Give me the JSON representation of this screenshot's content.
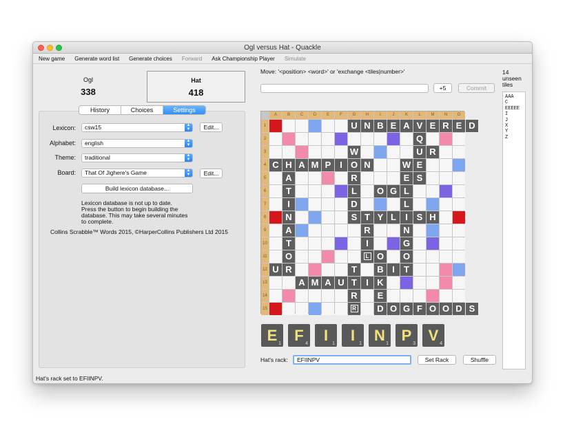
{
  "window": {
    "title": "Ogl versus Hat - Quackle"
  },
  "menu": {
    "items": [
      {
        "label": "New game",
        "enabled": true
      },
      {
        "label": "Generate word list",
        "enabled": true
      },
      {
        "label": "Generate choices",
        "enabled": true
      },
      {
        "label": "Forward",
        "enabled": false
      },
      {
        "label": "Ask Championship Player",
        "enabled": true
      },
      {
        "label": "Simulate",
        "enabled": false
      }
    ]
  },
  "players": [
    {
      "name": "Ogl",
      "score": "338"
    },
    {
      "name": "Hat",
      "score": "418"
    }
  ],
  "tabs": [
    "History",
    "Choices",
    "Settings"
  ],
  "settings": {
    "lexicon_label": "Lexicon:",
    "lexicon_value": "csw15",
    "alphabet_label": "Alphabet:",
    "alphabet_value": "english",
    "theme_label": "Theme:",
    "theme_value": "traditional",
    "board_label": "Board:",
    "board_value": "That Of Jighere's Game",
    "edit_label": "Edit...",
    "build_label": "Build lexicon database...",
    "note_lines": [
      "Lexicon database is not up to date.",
      "Press the button to begin building the",
      "database.  This may take several minutes",
      "to complete."
    ],
    "copyright": "Collins Scrabble™ Words 2015, ©HarperCollins Publishers Ltd 2015"
  },
  "move": {
    "label": "Move: '<position> <word>' or 'exchange <tiles|number>'",
    "input_value": "",
    "plus_label": "+5",
    "commit_label": "Commit"
  },
  "board": {
    "columns": [
      "A",
      "B",
      "C",
      "D",
      "E",
      "F",
      "G",
      "H",
      "I",
      "J",
      "K",
      "L",
      "M",
      "N",
      "O"
    ],
    "rows": [
      "1",
      "2",
      "3",
      "4",
      "5",
      "6",
      "7",
      "8",
      "9",
      "10",
      "11",
      "12",
      "13",
      "14",
      "15"
    ],
    "cells": [
      "TW . . DL . . U N B E A V E R E D",
      ". DW . . . TL . . . TL . Q . DW .",
      ". . DW . . . W . DL . . U R . .",
      "C H A M P I O N . . W E . . DL",
      ". A . . DW . R . . . E S . . .",
      ". T . . . TL L . O G L . . TL .",
      ". I DL . . . D . DL . L . DL . .",
      "TW N . DL . . S T Y L I S H . TW",
      ". A DL . . . . R . . N . DL . .",
      ". T . . . TL . I . TL G . TL . .",
      ". O . . DW . . [L] O . O . . . .",
      "U R . DW . . T . B I T . . DW DL",
      ". . A M A U T I K . TL . . DW .",
      ". DW . . . . R . E . . . DW . .",
      "TW . . DL . . [R] . D O G F O O D S"
    ]
  },
  "rack": {
    "tiles": [
      {
        "letter": "E",
        "points": "1"
      },
      {
        "letter": "F",
        "points": "4"
      },
      {
        "letter": "I",
        "points": "1"
      },
      {
        "letter": "I",
        "points": "1"
      },
      {
        "letter": "N",
        "points": "1"
      },
      {
        "letter": "P",
        "points": "3"
      },
      {
        "letter": "V",
        "points": "4"
      }
    ],
    "label": "Hat's rack:",
    "input_value": "EFIINPV",
    "set_rack_label": "Set Rack",
    "shuffle_label": "Shuffle"
  },
  "unseen": {
    "count": "14",
    "label_line1": "unseen",
    "label_line2": "tiles",
    "lines": [
      "AAA",
      "C",
      "EEEEE",
      "I",
      "J",
      "X",
      "Y",
      "Z"
    ]
  },
  "status": {
    "text": "Hat's rack set to EFIINPV."
  }
}
